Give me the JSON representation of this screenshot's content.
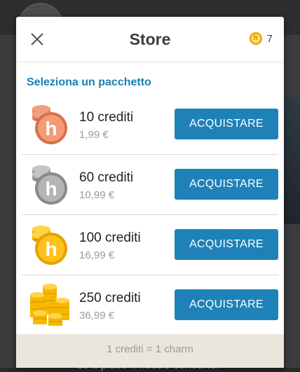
{
  "background": {
    "partial_text": "se ti piace il nostro concerto!"
  },
  "store": {
    "title": "Store",
    "balance": "7",
    "section_title": "Seleziona un pacchetto",
    "packages": [
      {
        "credits": "10 crediti",
        "price": "1,99 €",
        "button": "ACQUISTARE",
        "tier": "bronze"
      },
      {
        "credits": "60 crediti",
        "price": "10,99 €",
        "button": "ACQUISTARE",
        "tier": "silver"
      },
      {
        "credits": "100 crediti",
        "price": "16,99 €",
        "button": "ACQUISTARE",
        "tier": "gold"
      },
      {
        "credits": "250 crediti",
        "price": "36,99 €",
        "button": "ACQUISTARE",
        "tier": "gold-pile"
      }
    ],
    "footer_note": "1 crediti = 1 charm"
  },
  "colors": {
    "accent": "#1e82b9",
    "section_title": "#1a7fb3",
    "bronze": "#e8845e",
    "silver": "#9e9e9e",
    "gold": "#f5b800"
  },
  "icons": {
    "close": "close-icon",
    "coin": "h-coin-icon"
  }
}
